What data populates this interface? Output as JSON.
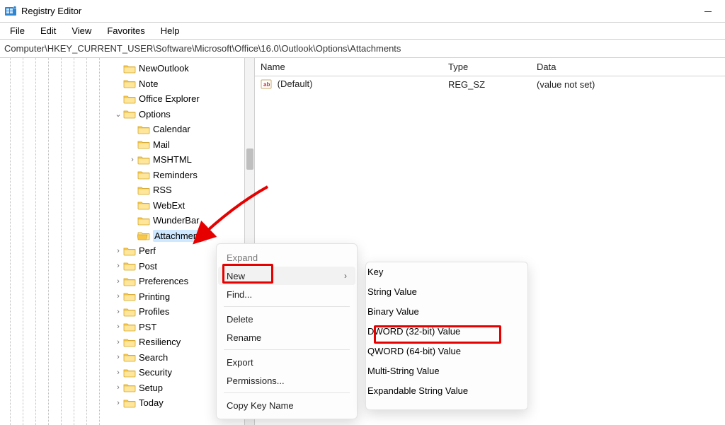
{
  "window": {
    "title": "Registry Editor"
  },
  "menubar": [
    "File",
    "Edit",
    "View",
    "Favorites",
    "Help"
  ],
  "address": "Computer\\HKEY_CURRENT_USER\\Software\\Microsoft\\Office\\16.0\\Outlook\\Options\\Attachments",
  "tree": {
    "items": [
      {
        "label": "NewOutlook",
        "twisty": "",
        "indent": 0,
        "selected": false
      },
      {
        "label": "Note",
        "twisty": "",
        "indent": 0,
        "selected": false
      },
      {
        "label": "Office Explorer",
        "twisty": "",
        "indent": 0,
        "selected": false
      },
      {
        "label": "Options",
        "twisty": "v",
        "indent": 0,
        "selected": false
      },
      {
        "label": "Calendar",
        "twisty": "",
        "indent": 1,
        "selected": false
      },
      {
        "label": "Mail",
        "twisty": "",
        "indent": 1,
        "selected": false
      },
      {
        "label": "MSHTML",
        "twisty": ">",
        "indent": 1,
        "selected": false
      },
      {
        "label": "Reminders",
        "twisty": "",
        "indent": 1,
        "selected": false
      },
      {
        "label": "RSS",
        "twisty": "",
        "indent": 1,
        "selected": false
      },
      {
        "label": "WebExt",
        "twisty": "",
        "indent": 1,
        "selected": false
      },
      {
        "label": "WunderBar",
        "twisty": "",
        "indent": 1,
        "selected": false
      },
      {
        "label": "Attachments",
        "twisty": "",
        "indent": 1,
        "selected": true
      },
      {
        "label": "Perf",
        "twisty": ">",
        "indent": 0,
        "selected": false
      },
      {
        "label": "Post",
        "twisty": ">",
        "indent": 0,
        "selected": false
      },
      {
        "label": "Preferences",
        "twisty": ">",
        "indent": 0,
        "selected": false
      },
      {
        "label": "Printing",
        "twisty": ">",
        "indent": 0,
        "selected": false
      },
      {
        "label": "Profiles",
        "twisty": ">",
        "indent": 0,
        "selected": false
      },
      {
        "label": "PST",
        "twisty": ">",
        "indent": 0,
        "selected": false
      },
      {
        "label": "Resiliency",
        "twisty": ">",
        "indent": 0,
        "selected": false
      },
      {
        "label": "Search",
        "twisty": ">",
        "indent": 0,
        "selected": false
      },
      {
        "label": "Security",
        "twisty": ">",
        "indent": 0,
        "selected": false
      },
      {
        "label": "Setup",
        "twisty": ">",
        "indent": 0,
        "selected": false
      },
      {
        "label": "Today",
        "twisty": ">",
        "indent": 0,
        "selected": false
      }
    ]
  },
  "list": {
    "columns": {
      "name": "Name",
      "type": "Type",
      "data": "Data"
    },
    "rows": [
      {
        "name": "(Default)",
        "type": "REG_SZ",
        "data": "(value not set)"
      }
    ]
  },
  "context_menu": {
    "items": [
      {
        "label": "Expand",
        "kind": "disabled"
      },
      {
        "label": "New",
        "kind": "submenu",
        "hovered": true
      },
      {
        "label": "Find...",
        "kind": "normal"
      },
      {
        "label": "-SEP-",
        "kind": "sep"
      },
      {
        "label": "Delete",
        "kind": "normal"
      },
      {
        "label": "Rename",
        "kind": "normal"
      },
      {
        "label": "-SEP-",
        "kind": "sep"
      },
      {
        "label": "Export",
        "kind": "normal"
      },
      {
        "label": "Permissions...",
        "kind": "normal"
      },
      {
        "label": "-SEP-",
        "kind": "sep"
      },
      {
        "label": "Copy Key Name",
        "kind": "normal"
      }
    ]
  },
  "submenu": {
    "items": [
      {
        "label": "Key"
      },
      {
        "label": "-SEP-"
      },
      {
        "label": "String Value"
      },
      {
        "label": "Binary Value"
      },
      {
        "label": "DWORD (32-bit) Value",
        "highlight": true
      },
      {
        "label": "QWORD (64-bit) Value"
      },
      {
        "label": "Multi-String Value"
      },
      {
        "label": "Expandable String Value"
      }
    ]
  }
}
